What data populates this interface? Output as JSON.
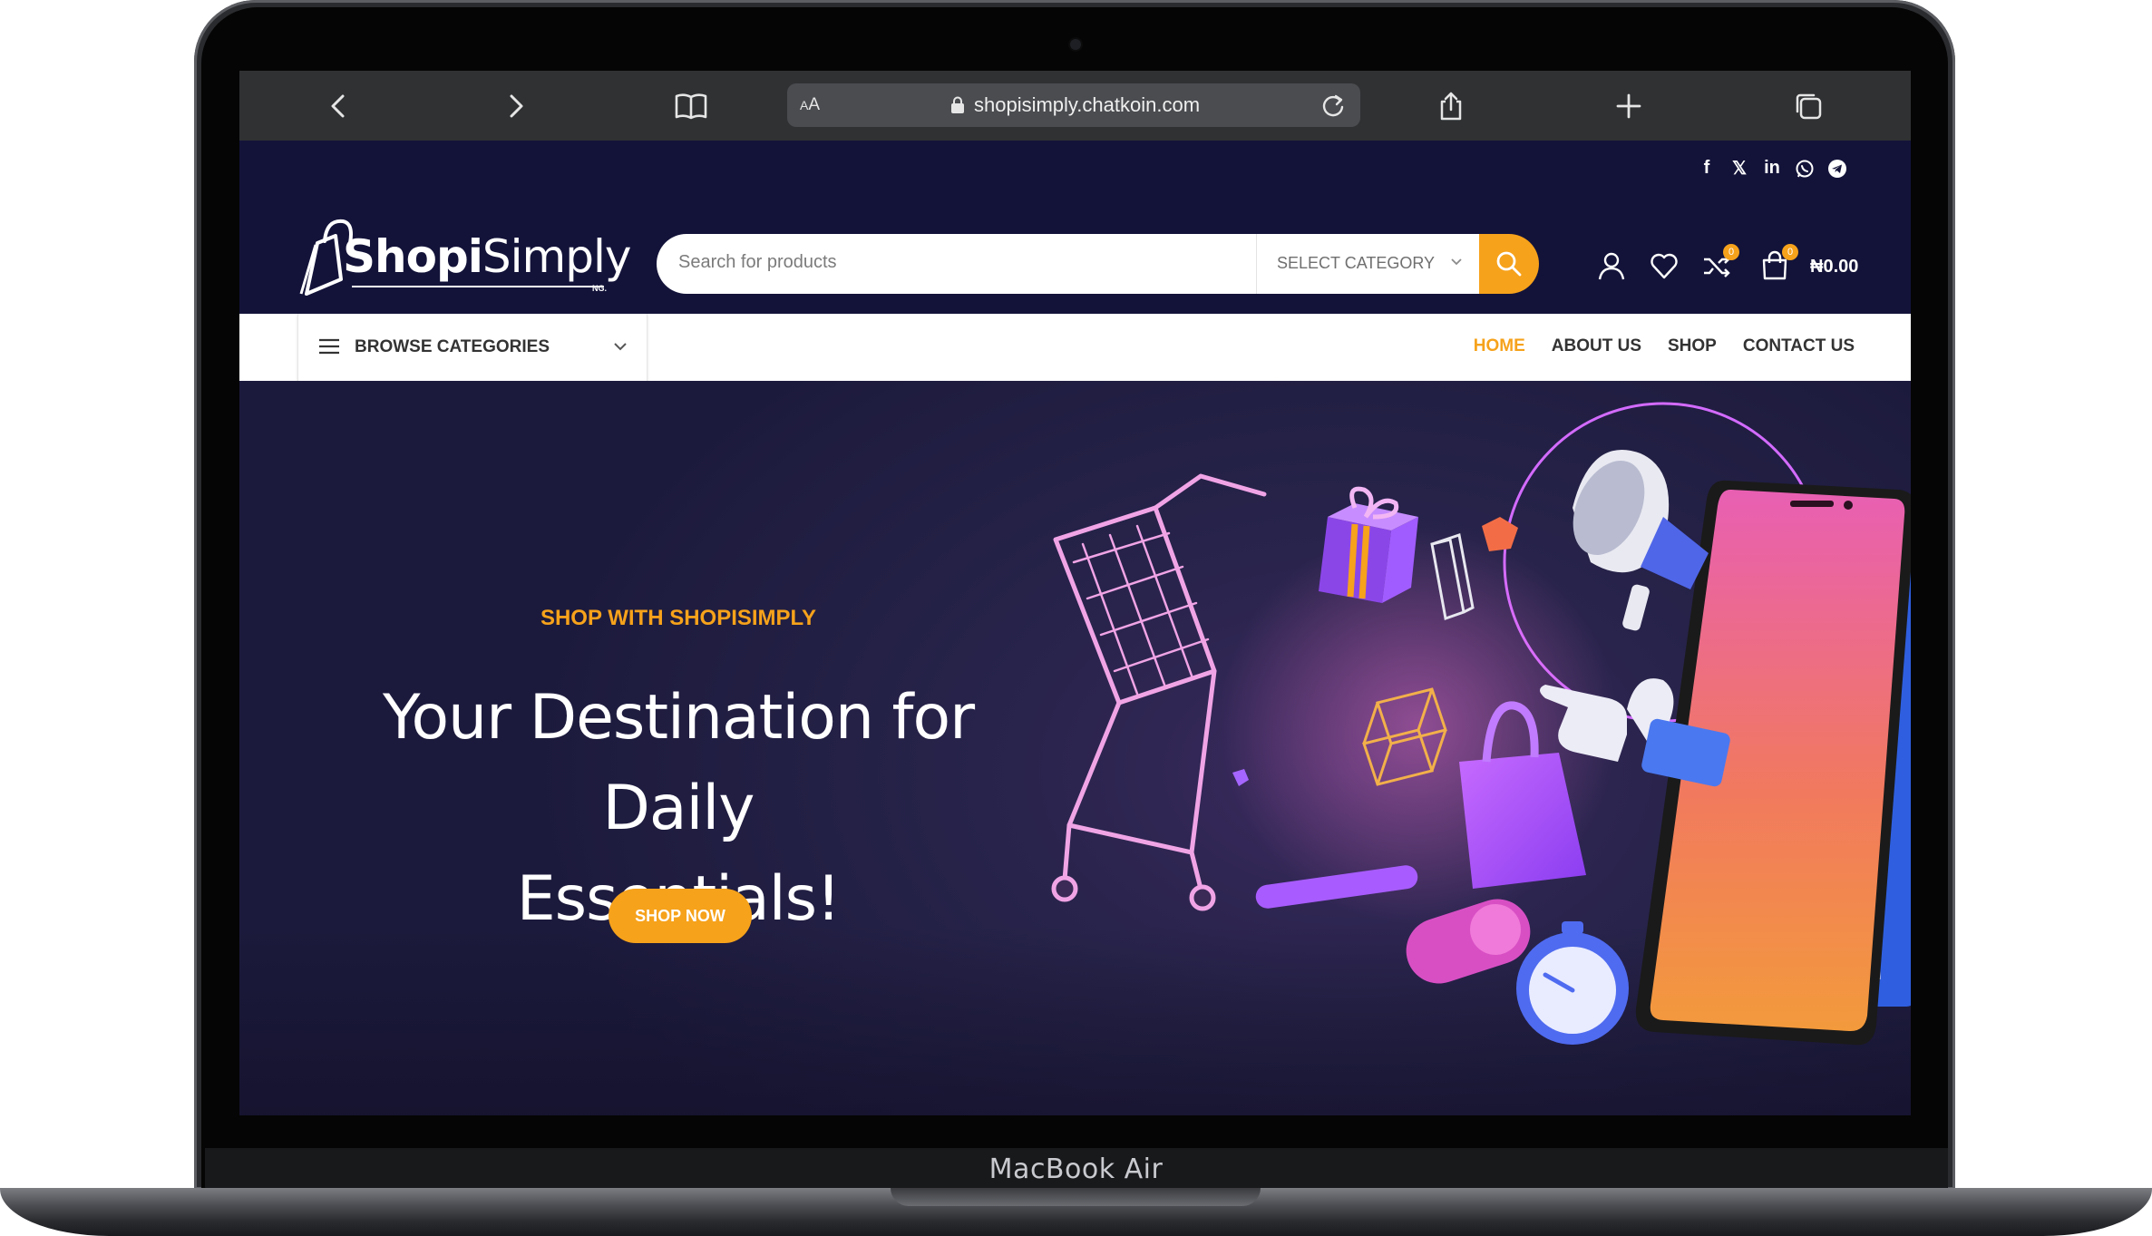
{
  "device": {
    "label": "MacBook Air"
  },
  "browser": {
    "url": "shopisimply.chatkoin.com",
    "reader_label": "AA"
  },
  "social": {
    "items": [
      "f",
      "X",
      "in",
      "whatsapp",
      "telegram"
    ],
    "glyphs": {
      "facebook": "f",
      "x": "𝕏",
      "linkedin": "in"
    }
  },
  "header": {
    "logo_text_bold": "Shopi",
    "logo_text_regular": "Simply",
    "logo_suffix": "NG.",
    "search_placeholder": "Search for products",
    "category_select": "SELECT CATEGORY",
    "compare_count": "0",
    "cart_count": "0",
    "cart_total": "₦0.00"
  },
  "nav": {
    "browse_label": "BROWSE CATEGORIES",
    "links": [
      "HOME",
      "ABOUT US",
      "SHOP",
      "CONTACT US"
    ],
    "active": "HOME"
  },
  "hero": {
    "kicker": "SHOP WITH SHOPISIMPLY",
    "title_line1": "Your Destination for Daily",
    "title_line2": "Essentials!",
    "button": "SHOP NOW"
  },
  "colors": {
    "accent": "#f6a21b",
    "navy": "#13133a",
    "toolbar": "#2f3133"
  }
}
